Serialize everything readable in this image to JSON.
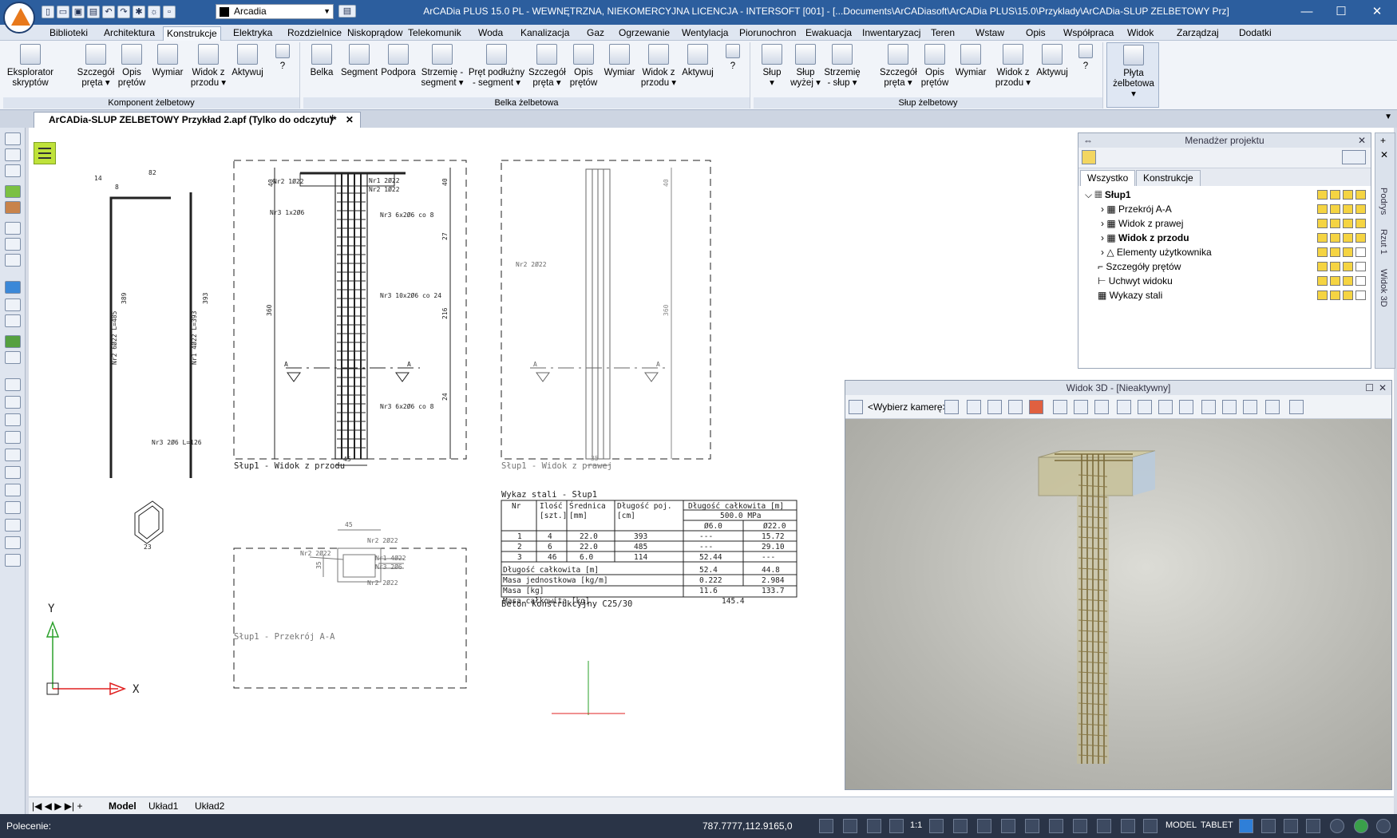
{
  "app": {
    "title": "ArCADia PLUS 15.0 PL - WEWNĘTRZNA, NIEKOMERCYJNA LICENCJA - INTERSOFT [001] - [...Documents\\ArCADiasoft\\ArCADia PLUS\\15.0\\Przyklady\\ArCADia-SLUP ZELBETOWY Prz]",
    "layer": "Arcadia"
  },
  "menu": [
    "Biblioteki",
    "Architektura",
    "Konstrukcje",
    "Elektryka",
    "Rozdzielnice",
    "Niskoprądow",
    "Telekomunik",
    "Woda",
    "Kanalizacja",
    "Gaz",
    "Ogrzewanie",
    "Wentylacja",
    "Piorunochron",
    "Ewakuacja",
    "Inwentaryzacj",
    "Teren",
    "Wstaw",
    "Opis",
    "Współpraca",
    "Widok",
    "Zarządzaj",
    "Dodatki"
  ],
  "menu_active": "Konstrukcje",
  "ribbon": {
    "groups": [
      "Komponent żelbetowy",
      "Belka żelbetowa",
      "Słup żelbetowy"
    ],
    "buttons": {
      "eksplorator": "Eksplorator\nskryptów",
      "szczegol": "Szczegół\npręta ▾",
      "opis": "Opis\nprętów",
      "wymiar": "Wymiar",
      "widok": "Widok z\nprzodu ▾",
      "aktywuj": "Aktywuj",
      "belka": "Belka",
      "segment": "Segment",
      "podpora": "Podpora",
      "strzemie_seg": "Strzemię -\nsegment ▾",
      "pret_podl": "Pręt podłużny\n- segment ▾",
      "slup": "Słup\n▾",
      "slup_wyzej": "Słup\nwyżej ▾",
      "strzemie_slup": "Strzemię\n- słup ▾",
      "plyta": "Płyta\nżelbetowa ▾",
      "q": "?"
    }
  },
  "doc_tab": "ArCADia-SLUP ZELBETOWY Przykład 2.apf (Tylko do odczytu)*",
  "drawing": {
    "views": [
      "Słup1 - Widok z przodu",
      "Słup1 - Widok z prawej",
      "Słup1 - Przekrój A-A"
    ],
    "labels": {
      "nr2": "Nr2 1Ø22",
      "nr1": "Nr1 2Ø22",
      "nr2b": "Nr2 1Ø22",
      "nr3a": "Nr3 1x2Ø6",
      "nr3b": "Nr3 6x2Ø6 co 8",
      "nr3c": "Nr3 10x2Ø6 co 24",
      "nr3d": "Nr3 6x2Ø6 co 8",
      "side_nr2": "Nr2 2Ø22",
      "bar2": "Nr2 6Ø22 L=485",
      "bar1": "Nr1 4Ø22 L=393",
      "bar3": "Nr3 2Ø6 L=126",
      "sec_nr2a": "Nr2 2Ø22",
      "sec_nr2b": "Nr2 2Ø22",
      "sec_nr1": "Nr1 4Ø22",
      "sec_nr3": "Nr3 2Ø6",
      "sec_nr2c": "Nr2 2Ø22",
      "d389": "389",
      "d393": "393",
      "d82": "82",
      "d14": "14",
      "d8": "8",
      "d40": "40",
      "d360": "360",
      "d45": "45",
      "d27": "27",
      "d216": "216",
      "d24": "24",
      "d35": "35",
      "d23": "23",
      "A": "A"
    }
  },
  "steel_table": {
    "title": "Wykaz stali - Słup1",
    "headers": [
      "Nr",
      "Ilość\n[szt.]",
      "Średnica\n[mm]",
      "Długość poj.\n[cm]",
      "Długość całkowita [m]"
    ],
    "grade": "500.0 MPa",
    "subheaders": [
      "Ø6.0",
      "Ø22.0"
    ],
    "rows": [
      [
        "1",
        "4",
        "22.0",
        "393",
        "---",
        "15.72"
      ],
      [
        "2",
        "6",
        "22.0",
        "485",
        "---",
        "29.10"
      ],
      [
        "3",
        "46",
        "6.0",
        "114",
        "52.44",
        "---"
      ]
    ],
    "summary": [
      [
        "Długość całkowita [m]",
        "52.4",
        "44.8"
      ],
      [
        "Masa jednostkowa [kg/m]",
        "0.222",
        "2.984"
      ],
      [
        "Masa [kg]",
        "11.6",
        "133.7"
      ],
      [
        "Masa całkowita [kg]",
        "145.4",
        ""
      ]
    ],
    "note": "Beton konstrukcyjny C25/30"
  },
  "project_manager": {
    "title": "Menadżer projektu",
    "tabs": [
      "Wszystko",
      "Konstrukcje"
    ],
    "tree": [
      {
        "label": "Słup1",
        "bold": true
      },
      {
        "label": "Przekrój A-A",
        "bold": false
      },
      {
        "label": "Widok z prawej",
        "bold": false
      },
      {
        "label": "Widok z przodu",
        "bold": true
      },
      {
        "label": "Elementy użytkownika",
        "bold": false
      },
      {
        "label": "Szczegóły prętów",
        "bold": false
      },
      {
        "label": "Uchwyt widoku",
        "bold": false
      },
      {
        "label": "Wykazy stali",
        "bold": false
      }
    ]
  },
  "side_tabs": [
    "Podrys",
    "Rzut 1",
    "Widok 3D"
  ],
  "view3d": {
    "title": "Widok 3D - [Nieaktywny]",
    "camera": "<Wybierz kamerę>"
  },
  "axes": {
    "y": "Y",
    "x": "X"
  },
  "layouts": [
    "Model",
    "Układ1",
    "Układ2"
  ],
  "status": {
    "command": "Polecenie:",
    "coords": "787.7777,112.9165,0",
    "scale": "1:1",
    "model": "MODEL",
    "tablet": "TABLET"
  }
}
